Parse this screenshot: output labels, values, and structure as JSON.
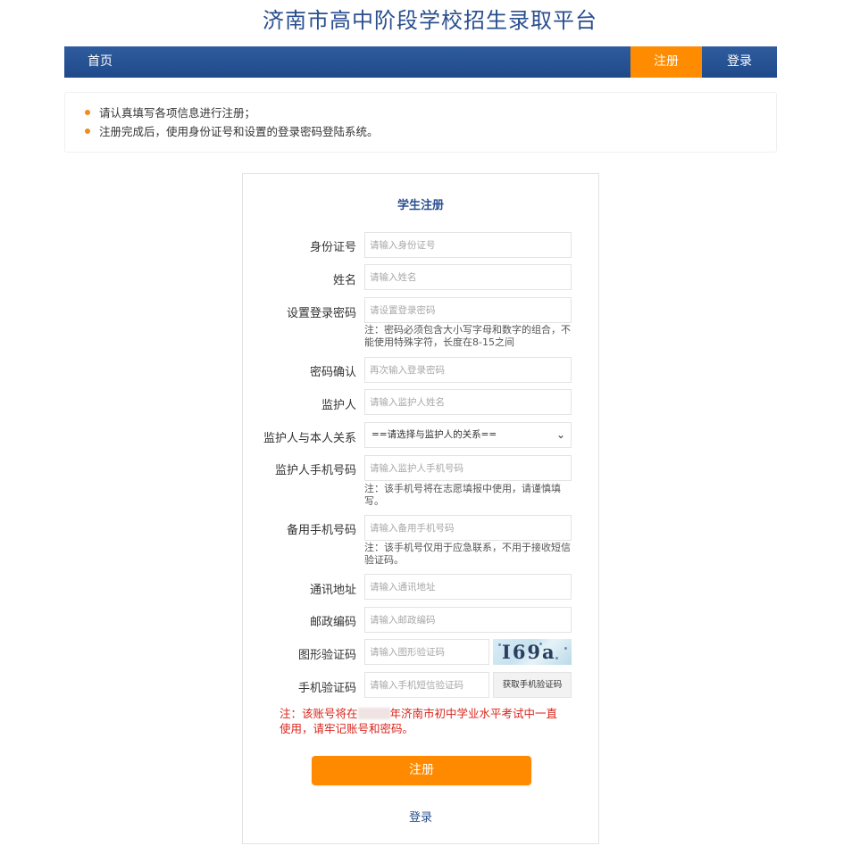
{
  "site_title": "济南市高中阶段学校招生录取平台",
  "nav": {
    "home": "首页",
    "register": "注册",
    "login": "登录"
  },
  "notice": [
    "请认真填写各项信息进行注册；",
    "注册完成后，使用身份证号和设置的登录密码登陆系统。"
  ],
  "form": {
    "title": "学生注册",
    "id_card": {
      "label": "身份证号",
      "placeholder": "请输入身份证号"
    },
    "name": {
      "label": "姓名",
      "placeholder": "请输入姓名"
    },
    "password": {
      "label": "设置登录密码",
      "placeholder": "请设置登录密码",
      "hint": "注：密码必须包含大小写字母和数字的组合，不能使用特殊字符，长度在8-15之间"
    },
    "confirm": {
      "label": "密码确认",
      "placeholder": "再次输入登录密码"
    },
    "guardian": {
      "label": "监护人",
      "placeholder": "请输入监护人姓名"
    },
    "relation": {
      "label": "监护人与本人关系",
      "selected": "==请选择与监护人的关系=="
    },
    "guardian_phone": {
      "label": "监护人手机号码",
      "placeholder": "请输入监护人手机号码",
      "hint": "注：该手机号将在志愿填报中使用，请谨慎填写。"
    },
    "backup_phone": {
      "label": "备用手机号码",
      "placeholder": "请输入备用手机号码",
      "hint": "注：该手机号仅用于应急联系，不用于接收短信验证码。"
    },
    "address": {
      "label": "通讯地址",
      "placeholder": "请输入通讯地址"
    },
    "postcode": {
      "label": "邮政编码",
      "placeholder": "请输入邮政编码"
    },
    "captcha": {
      "label": "图形验证码",
      "placeholder": "请输入图形验证码",
      "image_text": "I69a"
    },
    "sms": {
      "label": "手机验证码",
      "placeholder": "请输入手机短信验证码",
      "button": "获取手机验证码"
    },
    "warning_prefix": "注：该账号将在",
    "warning_suffix": "年济南市初中学业水平考试中一直使用，请牢记账号和密码。",
    "submit": "注册",
    "login_link": "登录"
  }
}
